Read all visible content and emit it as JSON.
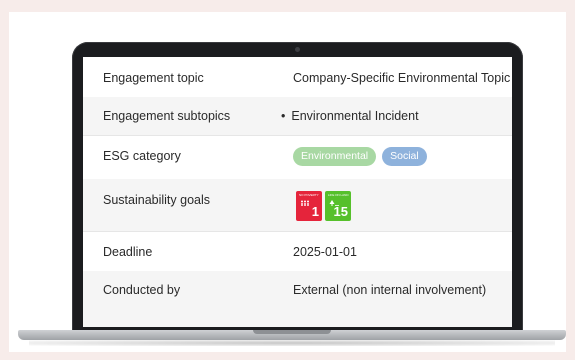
{
  "details": {
    "rows": [
      {
        "label": "Engagement topic",
        "value": "Company-Specific Environmental Topic"
      },
      {
        "label": "Engagement subtopics",
        "value": "Environmental Incident"
      },
      {
        "label": "ESG category",
        "tags": [
          "Environmental",
          "Social"
        ]
      },
      {
        "label": "Sustainability goals",
        "goals": [
          {
            "number": "1",
            "caption": "NO POVERTY",
            "icon": "family-icon",
            "color": "#e5243b"
          },
          {
            "number": "15",
            "caption": "LIFE ON LAND",
            "icon": "tree-icon",
            "color": "#56c02b"
          }
        ]
      },
      {
        "label": "Deadline",
        "value": "2025-01-01"
      },
      {
        "label": "Conducted by",
        "value": "External (non internal involvement)"
      }
    ]
  },
  "colors": {
    "tag_environmental": "#a8d8a3",
    "tag_social": "#8eb2dc",
    "page_background": "#f7ecea",
    "bezel": "#1b1c1f"
  }
}
